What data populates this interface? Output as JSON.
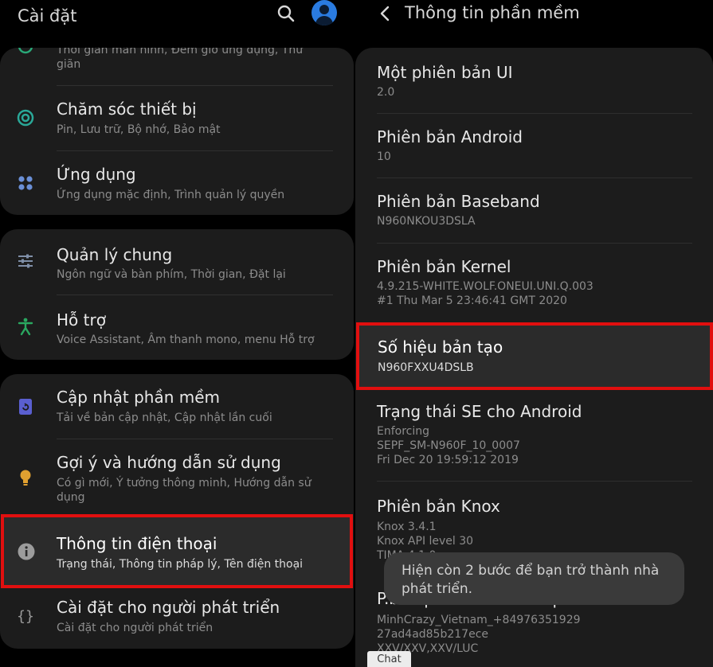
{
  "left": {
    "title": "Cài đặt",
    "items": [
      {
        "title": "",
        "sub": "Thời gian màn hình, Đếm giờ ứng dụng, Thư giãn"
      },
      {
        "title": "Chăm sóc thiết bị",
        "sub": "Pin, Lưu trữ, Bộ nhớ, Bảo mật"
      },
      {
        "title": "Ứng dụng",
        "sub": "Ứng dụng mặc định, Trình quản lý quyền"
      },
      {
        "title": "Quản lý chung",
        "sub": "Ngôn ngữ và bàn phím, Thời gian, Đặt lại"
      },
      {
        "title": "Hỗ trợ",
        "sub": "Voice Assistant, Âm thanh mono, menu Hỗ trợ"
      },
      {
        "title": "Cập nhật phần mềm",
        "sub": "Tải về bản cập nhật, Cập nhật lần cuối"
      },
      {
        "title": "Gợi ý và hướng dẫn sử dụng",
        "sub": "Có gì mới, Ý tưởng thông minh, Hướng dẫn sử dụng"
      },
      {
        "title": "Thông tin điện thoại",
        "sub": "Trạng thái, Thông tin pháp lý, Tên điện thoại"
      },
      {
        "title": "Cài đặt cho người phát triển",
        "sub": "Cài đặt cho người phát triển"
      }
    ]
  },
  "right": {
    "title": "Thông tin phần mềm",
    "items": [
      {
        "title": "Một phiên bản UI",
        "value": "2.0"
      },
      {
        "title": "Phiên bản Android",
        "value": "10"
      },
      {
        "title": "Phiên bản Baseband",
        "value": "N960NKOU3DSLA"
      },
      {
        "title": "Phiên bản Kernel",
        "value": "4.9.215-WHITE.WOLF.ONEUI.UNI.Q.003\n#1 Thu Mar 5 23:46:41 GMT 2020"
      },
      {
        "title": "Số hiệu bản tạo",
        "value": "N960FXXU4DSLB"
      },
      {
        "title": "Trạng thái SE cho Android",
        "value": "Enforcing\nSEPF_SM-N960F_10_0007\nFri Dec 20 19:59:12 2019"
      },
      {
        "title": "Phiên bản Knox",
        "value": "Knox 3.4.1\nKnox API level 30\nTIMA 4.1.0"
      },
      {
        "title": "P.bản p.mềm nhà c.cấp d.v",
        "value": "MinhCrazy_Vietnam_+84976351929\n27ad4ad85b217ece\nXXV/XXV,XXV/LUC"
      }
    ]
  },
  "toast": "Hiện còn 2 bước để bạn trở thành nhà phát triển.",
  "chat_tab": "Chat",
  "colors": {
    "highlight": "#e10f0f",
    "accent_blue": "#2a7be0",
    "card_bg": "#1c1c1c"
  },
  "icons": [
    "search-icon",
    "account-icon",
    "back-arrow-icon",
    "wellbeing-icon",
    "device-care-icon",
    "apps-icon",
    "general-management-icon",
    "accessibility-icon",
    "software-update-icon",
    "tips-bulb-icon",
    "info-icon",
    "developer-braces-icon"
  ]
}
